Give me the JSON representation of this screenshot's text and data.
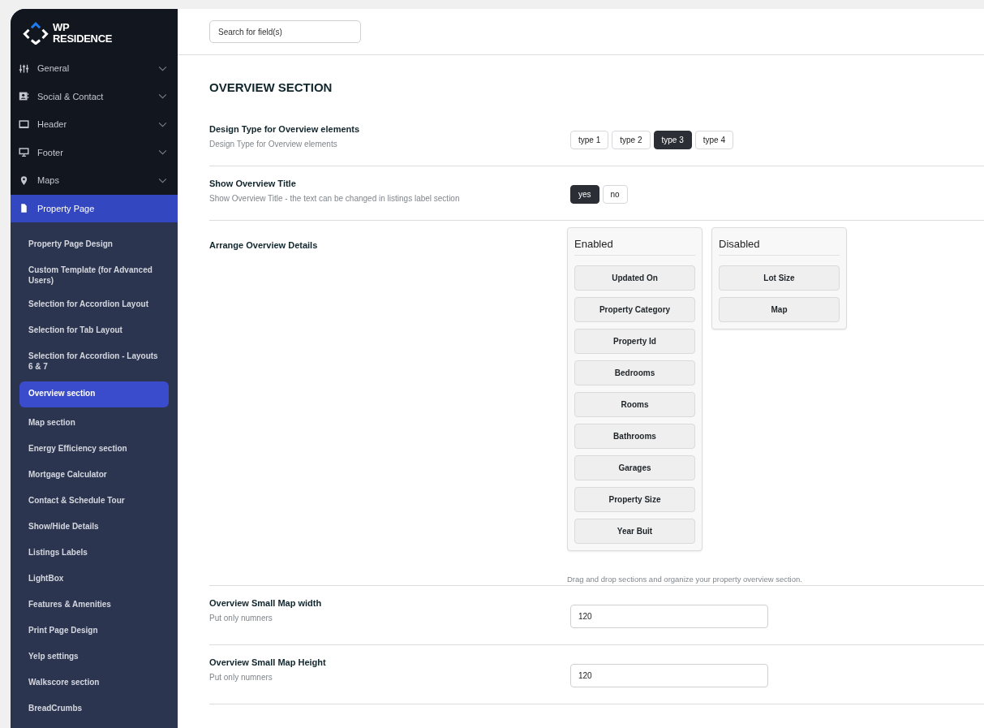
{
  "logo": {
    "line1": "WP",
    "line2": "RESIDENCE"
  },
  "sidebar": {
    "menu": [
      {
        "label": "General",
        "selected": false,
        "chevron": true
      },
      {
        "label": "Social & Contact",
        "selected": false,
        "chevron": true
      },
      {
        "label": "Header",
        "selected": false,
        "chevron": true
      },
      {
        "label": "Footer",
        "selected": false,
        "chevron": true
      },
      {
        "label": "Maps",
        "selected": false,
        "chevron": true
      },
      {
        "label": "Property Page",
        "selected": true,
        "chevron": false
      }
    ],
    "submenu": [
      {
        "label": "Property Page Design",
        "selected": false
      },
      {
        "label": "Custom Template (for Advanced Users)",
        "selected": false
      },
      {
        "label": "Selection for Accordion Layout",
        "selected": false
      },
      {
        "label": "Selection for Tab Layout",
        "selected": false
      },
      {
        "label": "Selection for Accordion - Layouts 6 & 7",
        "selected": false
      },
      {
        "label": "Overview section",
        "selected": true
      },
      {
        "label": "Map section",
        "selected": false
      },
      {
        "label": "Energy Efficiency section",
        "selected": false
      },
      {
        "label": "Mortgage Calculator",
        "selected": false
      },
      {
        "label": "Contact & Schedule Tour",
        "selected": false
      },
      {
        "label": "Show/Hide Details",
        "selected": false
      },
      {
        "label": "Listings Labels",
        "selected": false
      },
      {
        "label": "LightBox",
        "selected": false
      },
      {
        "label": "Features & Amenities",
        "selected": false
      },
      {
        "label": "Print Page Design",
        "selected": false
      },
      {
        "label": "Yelp settings",
        "selected": false
      },
      {
        "label": "Walkscore section",
        "selected": false
      },
      {
        "label": "BreadCrumbs",
        "selected": false
      }
    ]
  },
  "search": {
    "placeholder": "Search for field(s)"
  },
  "section_title": "OVERVIEW SECTION",
  "settings": [
    {
      "kind": "choice",
      "title": "Design Type for Overview elements",
      "description": "Design Type for Overview elements",
      "options": [
        {
          "label": "type 1",
          "selected": false
        },
        {
          "label": "type 2",
          "selected": false
        },
        {
          "label": "type 3",
          "selected": true
        },
        {
          "label": "type 4",
          "selected": false
        }
      ]
    },
    {
      "kind": "choice",
      "title": "Show Overview Title",
      "description": "Show Overview Title - the text can be changed in listings label section",
      "options": [
        {
          "label": "yes",
          "selected": true
        },
        {
          "label": "no",
          "selected": false
        }
      ]
    },
    {
      "kind": "sortable",
      "title": "Arrange Overview Details",
      "lists": [
        {
          "heading": "Enabled",
          "items": [
            "Updated On",
            "Property Category",
            "Property Id",
            "Bedrooms",
            "Rooms",
            "Bathrooms",
            "Garages",
            "Property Size",
            "Year Buit"
          ]
        },
        {
          "heading": "Disabled",
          "items": [
            "Lot Size",
            "Map"
          ]
        }
      ],
      "note": "Drag and drop sections and organize your property overview section."
    },
    {
      "kind": "input",
      "title": "Overview Small Map width",
      "description": "Put only numners",
      "value": "120"
    },
    {
      "kind": "input",
      "title": "Overview Small Map Height",
      "description": "Put only numners",
      "value": "120"
    }
  ]
}
